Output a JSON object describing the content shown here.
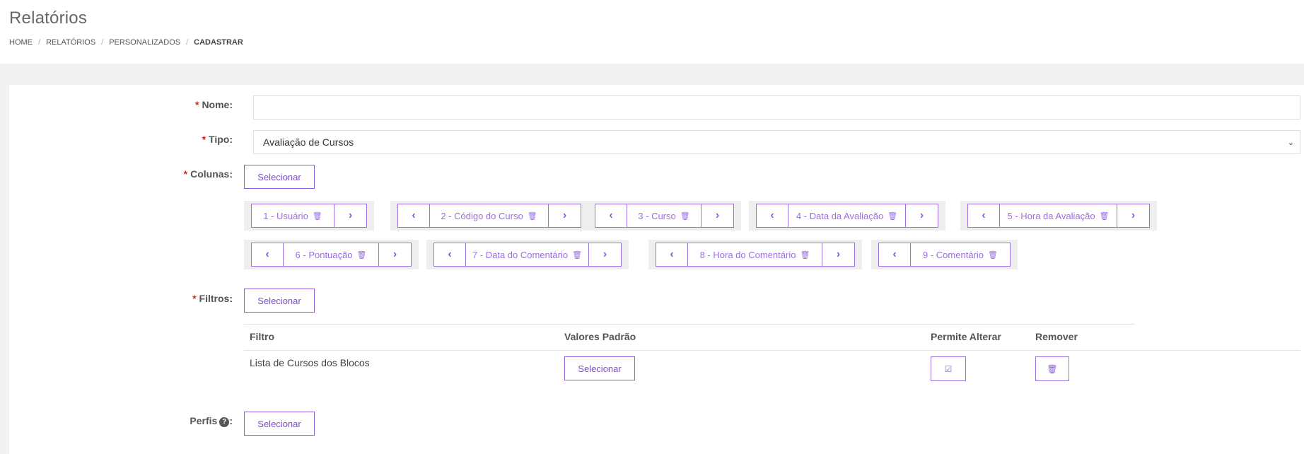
{
  "page": {
    "title": "Relatórios",
    "breadcrumb": [
      "HOME",
      "RELATÓRIOS",
      "PERSONALIZADOS",
      "CADASTRAR"
    ]
  },
  "form": {
    "nome": {
      "label": "Nome:",
      "value": "",
      "required": true
    },
    "tipo": {
      "label": "Tipo:",
      "value": "Avaliação de Cursos",
      "required": true
    },
    "colunas": {
      "label": "Colunas:",
      "required": true,
      "button": "Selecionar",
      "items": [
        "1 - Usuário",
        "2 - Código do Curso",
        "3 - Curso",
        "4 - Data da Avaliação",
        "5 - Hora da Avaliação",
        "6 - Pontuação",
        "7 - Data do Comentário",
        "8 - Hora do Comentário",
        "9 - Comentário"
      ]
    },
    "filtros": {
      "label": "Filtros:",
      "required": true,
      "button": "Selecionar",
      "table": {
        "headers": [
          "Filtro",
          "Valores Padrão",
          "Permite Alterar",
          "Remover"
        ],
        "rows": [
          {
            "filtro": "Lista de Cursos dos Blocos",
            "valores_button": "Selecionar"
          }
        ]
      }
    },
    "perfis": {
      "label": "Perfis",
      "button": "Selecionar"
    }
  },
  "icons": {
    "chevron_left": "chevron-left-icon",
    "chevron_right": "chevron-right-icon",
    "trash": "trash-icon",
    "check": "check-square-icon",
    "help": "question-circle-icon"
  },
  "colors": {
    "accent": "#8e5cd9",
    "required": "#e02020",
    "band": "#f1f1f1"
  }
}
